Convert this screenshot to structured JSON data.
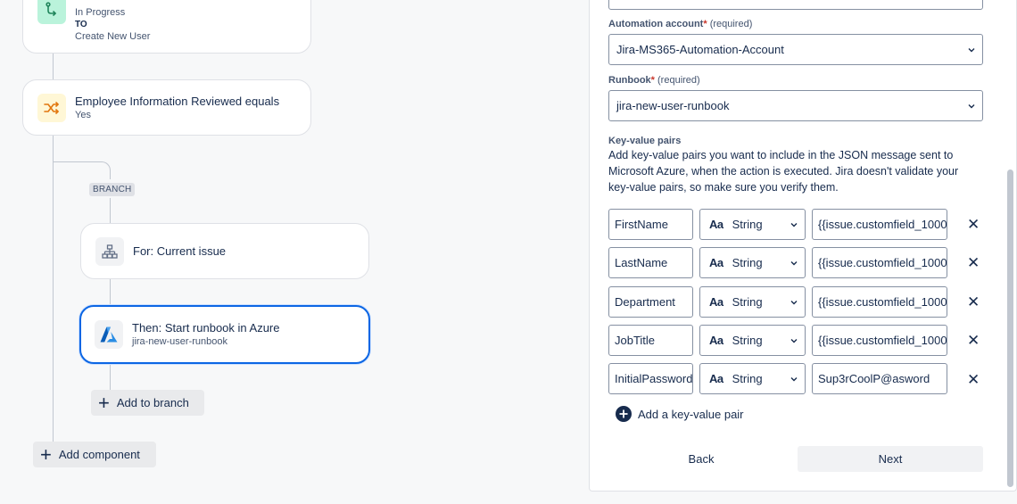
{
  "flow": {
    "trigger": {
      "status_line": "In Progress",
      "to": "TO",
      "target": "Create New User"
    },
    "condition": {
      "title": "Employee Information Reviewed equals",
      "value": "Yes"
    },
    "branch_tag": "BRANCH",
    "for_card": {
      "title": "For: Current issue"
    },
    "action_card": {
      "title": "Then: Start runbook in Azure",
      "subtitle": "jira-new-user-runbook"
    },
    "add_to_branch": "Add to branch",
    "add_component": "Add component"
  },
  "form": {
    "automation_account": {
      "label": "Automation account",
      "asterisk": "*",
      "required": "(required)",
      "value": "Jira-MS365-Automation-Account"
    },
    "runbook": {
      "label": "Runbook",
      "asterisk": "*",
      "required": "(required)",
      "value": "jira-new-user-runbook"
    },
    "kv": {
      "label": "Key-value pairs",
      "description_lines": [
        "Add key-value pairs you want to include in the JSON message sent to",
        "Microsoft Azure, when the action is executed. Jira doesn't validate your",
        "key-value pairs, so make sure you verify them."
      ],
      "type_icon": "Aa",
      "rows": [
        {
          "key": "FirstName",
          "type": "String",
          "value": "{{issue.customfield_1000"
        },
        {
          "key": "LastName",
          "type": "String",
          "value": "{{issue.customfield_1000"
        },
        {
          "key": "Department",
          "type": "String",
          "value": "{{issue.customfield_1000"
        },
        {
          "key": "JobTitle",
          "type": "String",
          "value": "{{issue.customfield_1000"
        },
        {
          "key": "InitialPassword",
          "type": "String",
          "value": "Sup3rCoolP@asword"
        }
      ],
      "add_pair": "Add a key-value pair"
    },
    "back": "Back",
    "next": "Next"
  },
  "colors": {
    "accent": "#0c66e4",
    "required": "#c9372c",
    "trigger_icon_bg": "#baf3db",
    "condition_icon_bg": "#fff7d6",
    "azure": "#0078d4"
  }
}
